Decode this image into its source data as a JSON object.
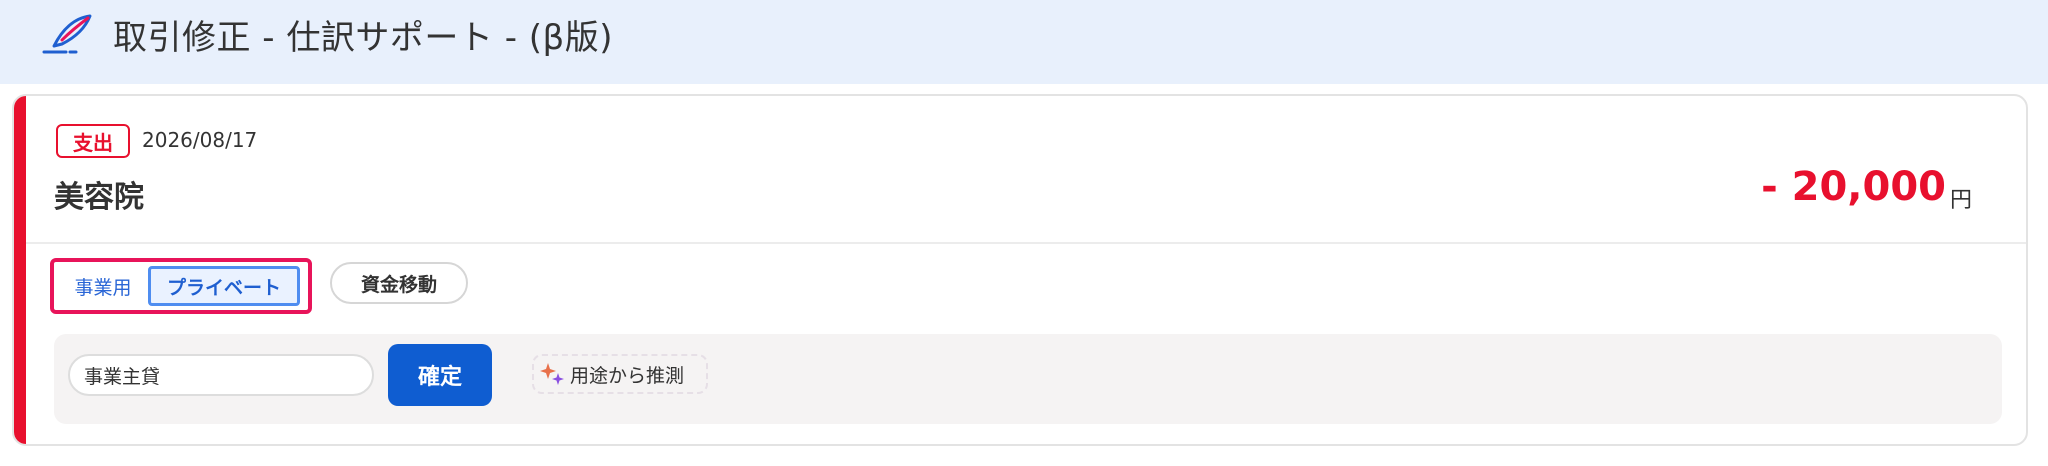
{
  "header": {
    "title": "取引修正 - 仕訳サポート - (β版)",
    "logo_icon": "quill-pen-icon"
  },
  "transaction": {
    "type_badge": "支出",
    "date": "2026/08/17",
    "payee": "美容院",
    "amount": "- 20,000",
    "currency_unit": "円",
    "accent_color": "#e8102e"
  },
  "classification": {
    "business_label": "事業用",
    "private_label": "プライベート",
    "selected": "プライベート",
    "transfer_label": "資金移動"
  },
  "account_panel": {
    "account_value": "事業主貸",
    "confirm_label": "確定",
    "infer_label": "用途から推測",
    "infer_icon": "sparkle-icon",
    "confirm_color": "#0f5dd1"
  }
}
